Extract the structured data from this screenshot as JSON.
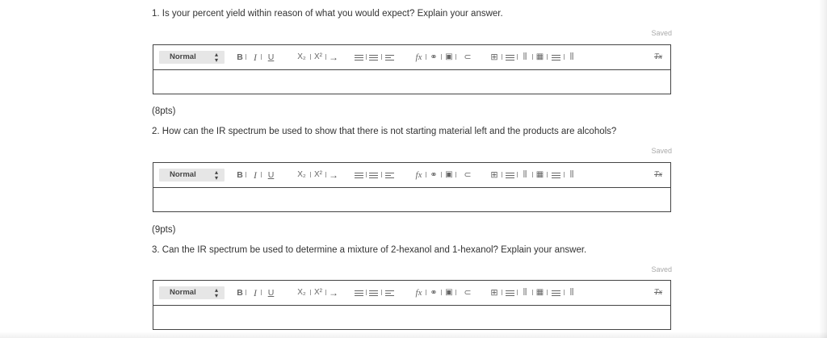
{
  "questions": [
    {
      "text": "1. Is your percent yield within reason of what you would expect? Explain your answer.",
      "saved": "Saved",
      "points": "(8pts)"
    },
    {
      "text": "2. How can the IR spectrum be used to show that there is not starting material left and the products are alcohols?",
      "saved": "Saved",
      "points": "(9pts)"
    },
    {
      "text": "3. Can the IR spectrum be used to determine a mixture of 2-hexanol and 1-hexanol? Explain your answer.",
      "saved": "Saved"
    }
  ],
  "toolbar": {
    "format_select": "Normal",
    "bold": "B",
    "italic": "I",
    "underline": "U",
    "subscript": "X₂",
    "superscript": "X²",
    "formula": "fx",
    "clear_format": "Tx"
  },
  "icons": [
    "format-select-arrows-icon",
    "bold-icon",
    "italic-icon",
    "underline-icon",
    "subscript-icon",
    "superscript-icon",
    "arrow-right-icon",
    "ordered-list-icon",
    "unordered-list-icon",
    "align-icon",
    "formula-icon",
    "link-icon",
    "image-icon",
    "attachment-icon",
    "table-icon",
    "table-row-icon",
    "table-column-icon",
    "table-cell-icon",
    "table-delete-icon",
    "table-merge-icon",
    "clear-format-icon"
  ]
}
